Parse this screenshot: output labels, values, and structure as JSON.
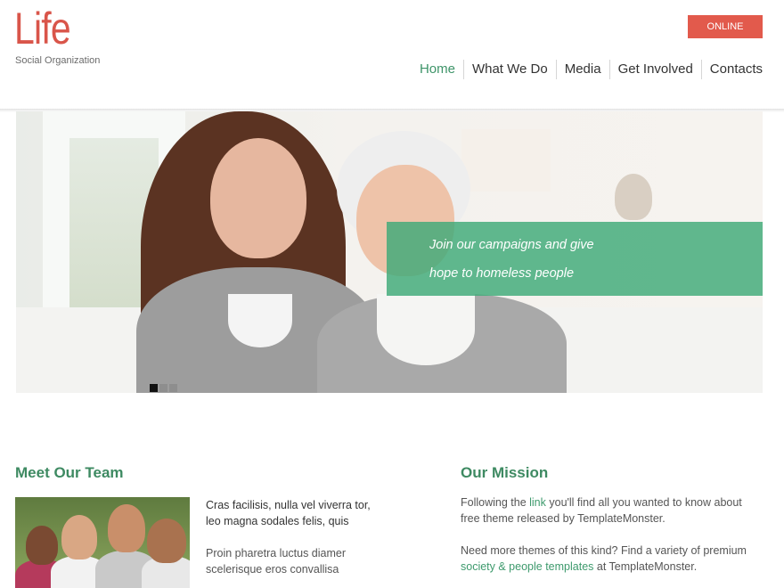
{
  "header": {
    "logo_title": "Life",
    "logo_subtitle": "Social Organization",
    "online_button": "ONLINE"
  },
  "nav": {
    "items": [
      {
        "label": "Home",
        "active": true
      },
      {
        "label": "What We Do",
        "active": false
      },
      {
        "label": "Media",
        "active": false
      },
      {
        "label": "Get Involved",
        "active": false
      },
      {
        "label": "Contacts",
        "active": false
      }
    ]
  },
  "hero": {
    "caption_line1": "Join our campaigns and give",
    "caption_line2": "hope to homeless people",
    "slider_dots": 3,
    "active_dot": 0
  },
  "team": {
    "title": "Meet Our Team",
    "paragraph1": "Cras facilisis, nulla vel viverra tor, leo magna sodales felis, quis",
    "paragraph2": "Proin pharetra luctus diamer scelerisque eros convallisa"
  },
  "mission": {
    "title": "Our Mission",
    "p1_before": "Following the ",
    "p1_link": "link",
    "p1_after": " you'll find all you wanted to know about free theme released by TemplateMonster.",
    "p2_before": "Need more themes of this kind? Find a variety of premium ",
    "p2_link": "society & people templates",
    "p2_after": " at TemplateMonster."
  },
  "colors": {
    "brand_red": "#d9554a",
    "button_red": "#e25a4c",
    "accent_green": "#3e9469",
    "caption_green": "#3ea978"
  },
  "icons": {
    "slider_dot": "square-bullet-icon"
  }
}
